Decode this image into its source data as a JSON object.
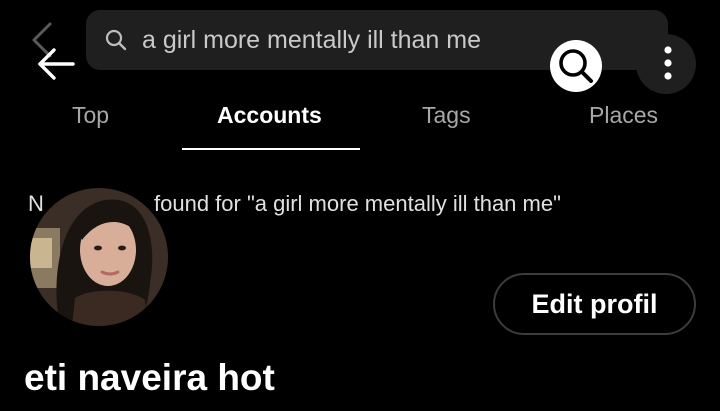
{
  "search": {
    "query": "a girl more mentally ill than me"
  },
  "tabs": [
    {
      "label": "Top"
    },
    {
      "label": "Accounts"
    },
    {
      "label": "Tags"
    },
    {
      "label": "Places"
    }
  ],
  "results": {
    "visible_start": "N",
    "visible_rest": "found for \"a girl more mentally ill than me\""
  },
  "profile": {
    "edit_button_label": "Edit profil",
    "display_name": "eti naveira hot"
  },
  "icons": {
    "back": "arrow-left-icon",
    "search": "search-icon",
    "more": "kebab-menu-icon"
  },
  "colors": {
    "background": "#000000",
    "search_bar": "#1f1f1f",
    "muted_text": "#a8a8a8",
    "button_border": "#3c3c3c"
  }
}
